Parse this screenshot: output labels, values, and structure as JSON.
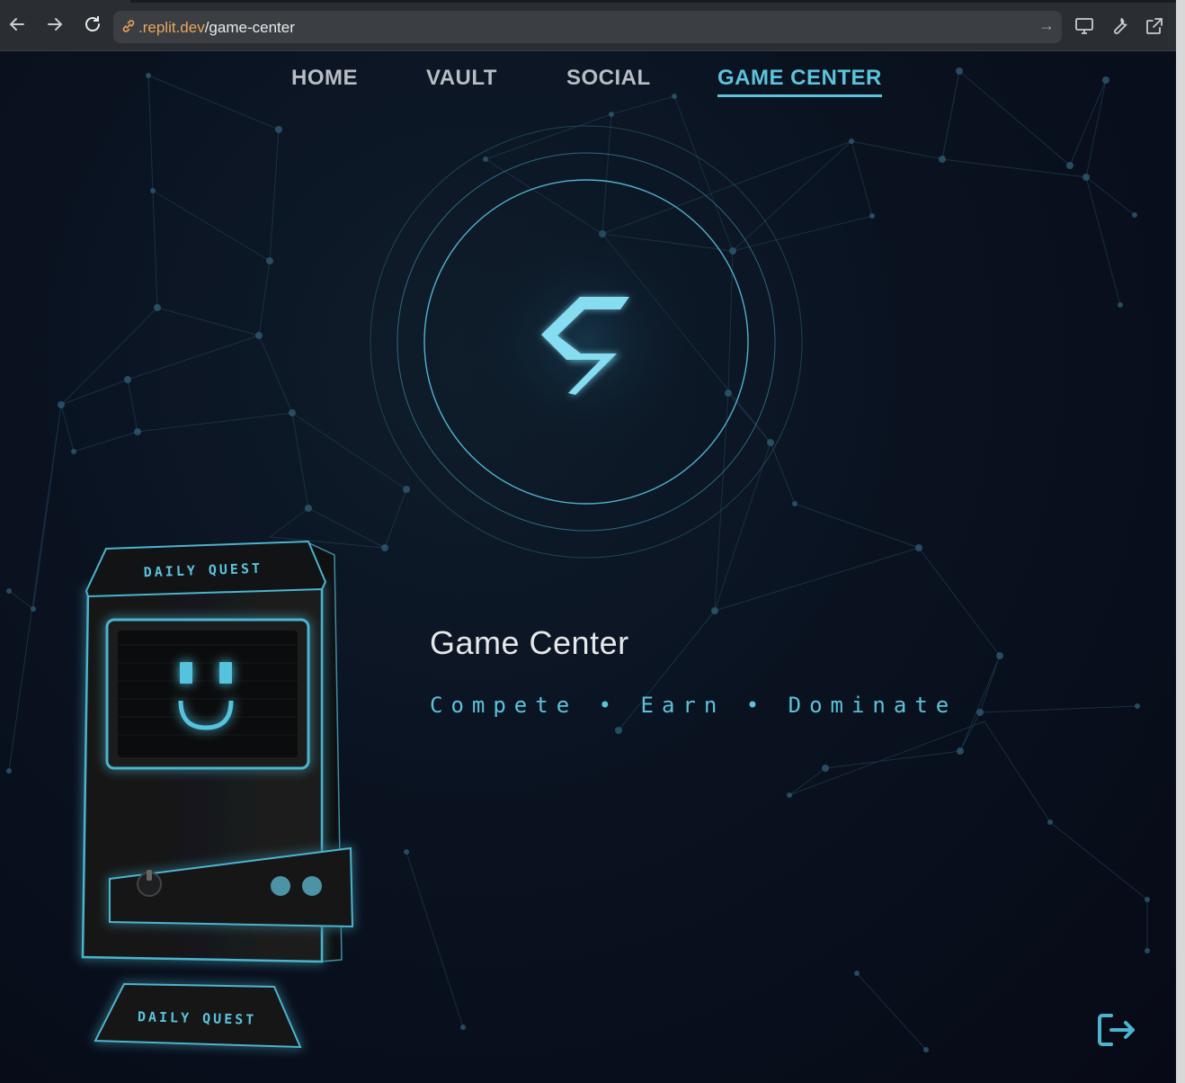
{
  "browser": {
    "url_host": ".replit.dev",
    "url_path": "/game-center"
  },
  "nav": {
    "items": [
      "HOME",
      "VAULT",
      "SOCIAL",
      "GAME CENTER"
    ],
    "active": "GAME CENTER"
  },
  "hero": {
    "title": "Game Center",
    "subtitle": "Compete • Earn • Dominate"
  },
  "arcade": {
    "marquee_label": "DAILY QUEST",
    "base_label": "DAILY QUEST"
  },
  "colors": {
    "accent": "#5bc3dc",
    "background": "#070b14"
  }
}
